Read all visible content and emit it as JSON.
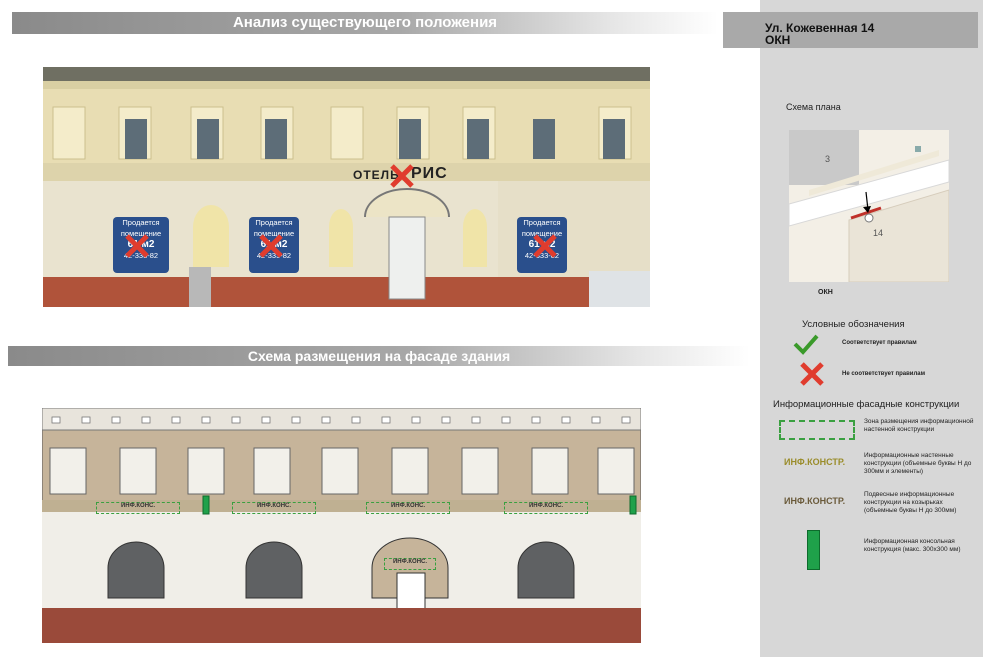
{
  "header": {
    "analysis_title": "Анализ существующего положения",
    "facade_title": "Схема размещения на фасаде здания"
  },
  "sidebar": {
    "address_line1": "Ул. Кожевенная 14",
    "address_line2": "ОКН",
    "plan_label": "Схема плана",
    "plan_numbers": [
      "3",
      "14"
    ],
    "okn_label": "ОКН",
    "legend_title": "Условные обозначения",
    "legend_ok": "Соответствует правилам",
    "legend_bad": "Не соответствует правилам",
    "facade_legend_title": "Информационные фасадные конструкции",
    "items": [
      {
        "desc": "Зона размещения информационной настенной конструкции"
      },
      {
        "swatch": "ИНФ.КОНСТР.",
        "desc": "Информационные настенные конструкции (объемные буквы Н до 300мм и элементы)"
      },
      {
        "swatch": "ИНФ.КОНСТР.",
        "desc": "Подвесные информационные конструкции на козырьках (объемные буквы Н до 300мм)"
      },
      {
        "desc": "Информационная консольная конструкция (макс. 300х300 мм)"
      }
    ]
  },
  "photo": {
    "sign_left": "ОТЕЛЬ",
    "sign_right": "РИС",
    "poster_lines": [
      "Продается",
      "помещение",
      "61 м2",
      "42-333-82"
    ]
  },
  "scheme": {
    "sign_label": "ИНФ.КОНС.",
    "arch_label": "ИНФ.КОНС."
  },
  "colors": {
    "ok_check": "#3a9a2a",
    "bad_cross": "#e03c2e",
    "zone_border": "#3aa040",
    "console_green": "#1fa14a",
    "facade_beige": "#c6b49a",
    "base_red": "#9a4a3a"
  }
}
